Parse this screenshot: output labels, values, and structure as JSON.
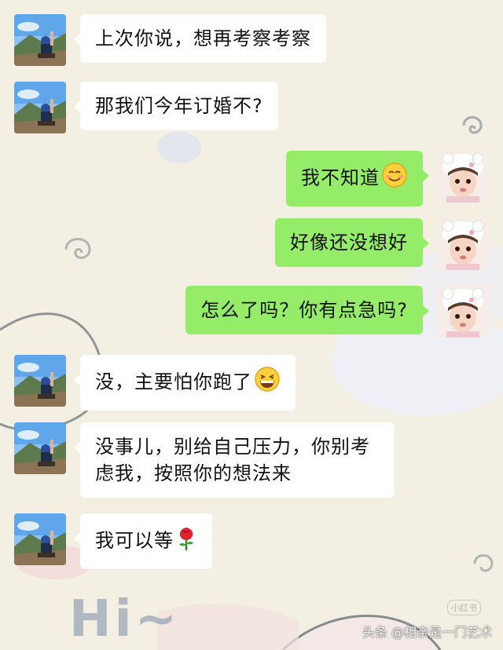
{
  "messages": [
    {
      "side": "left",
      "text": "上次你说，想再考察考察",
      "emoji": ""
    },
    {
      "side": "left",
      "text": "那我们今年订婚不?",
      "emoji": ""
    },
    {
      "side": "right",
      "text": "我不知道",
      "emoji": "smile-blush"
    },
    {
      "side": "right",
      "text": "好像还没想好",
      "emoji": ""
    },
    {
      "side": "right",
      "text": "怎么了吗？你有点急吗?",
      "emoji": ""
    },
    {
      "side": "left",
      "text": "没，主要怕你跑了",
      "emoji": "grin"
    },
    {
      "side": "left",
      "text": "没事儿，别给自己压力，你别考虑我，按照你的想法来",
      "emoji": ""
    },
    {
      "side": "left",
      "text": "我可以等",
      "emoji": "rose"
    }
  ],
  "background": {
    "greeting": "Hi~",
    "stamp": "小红书"
  },
  "watermark": "头条 @相亲是一门艺术",
  "colors": {
    "sent_bubble": "#95ec69",
    "received_bubble": "#ffffff",
    "background": "#f3f0e3"
  }
}
